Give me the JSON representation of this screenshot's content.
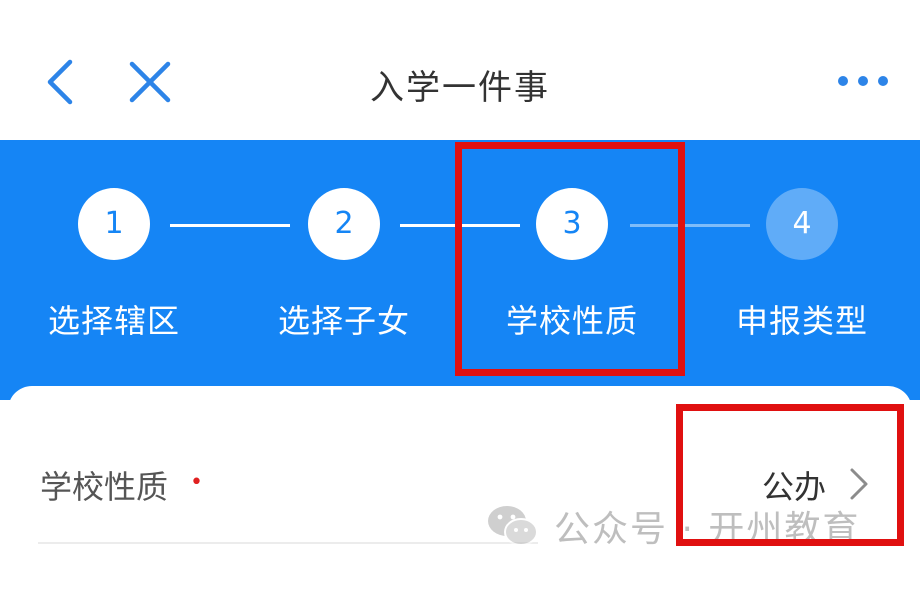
{
  "header": {
    "title": "入学一件事",
    "icons": {
      "back": "chevron-left-icon",
      "close": "close-icon",
      "more": "more-dots-icon"
    }
  },
  "stepper": {
    "steps": [
      {
        "number": "1",
        "label": "选择辖区",
        "state": "completed"
      },
      {
        "number": "2",
        "label": "选择子女",
        "state": "completed"
      },
      {
        "number": "3",
        "label": "学校性质",
        "state": "current"
      },
      {
        "number": "4",
        "label": "申报类型",
        "state": "upcoming"
      }
    ]
  },
  "form": {
    "school_type": {
      "label": "学校性质",
      "required_mark": "•",
      "value": "公办"
    }
  },
  "watermark": {
    "text": "公众号 · 开州教育"
  },
  "colors": {
    "primary": "#1585f5",
    "highlight": "#e01010",
    "required": "#e02020"
  }
}
